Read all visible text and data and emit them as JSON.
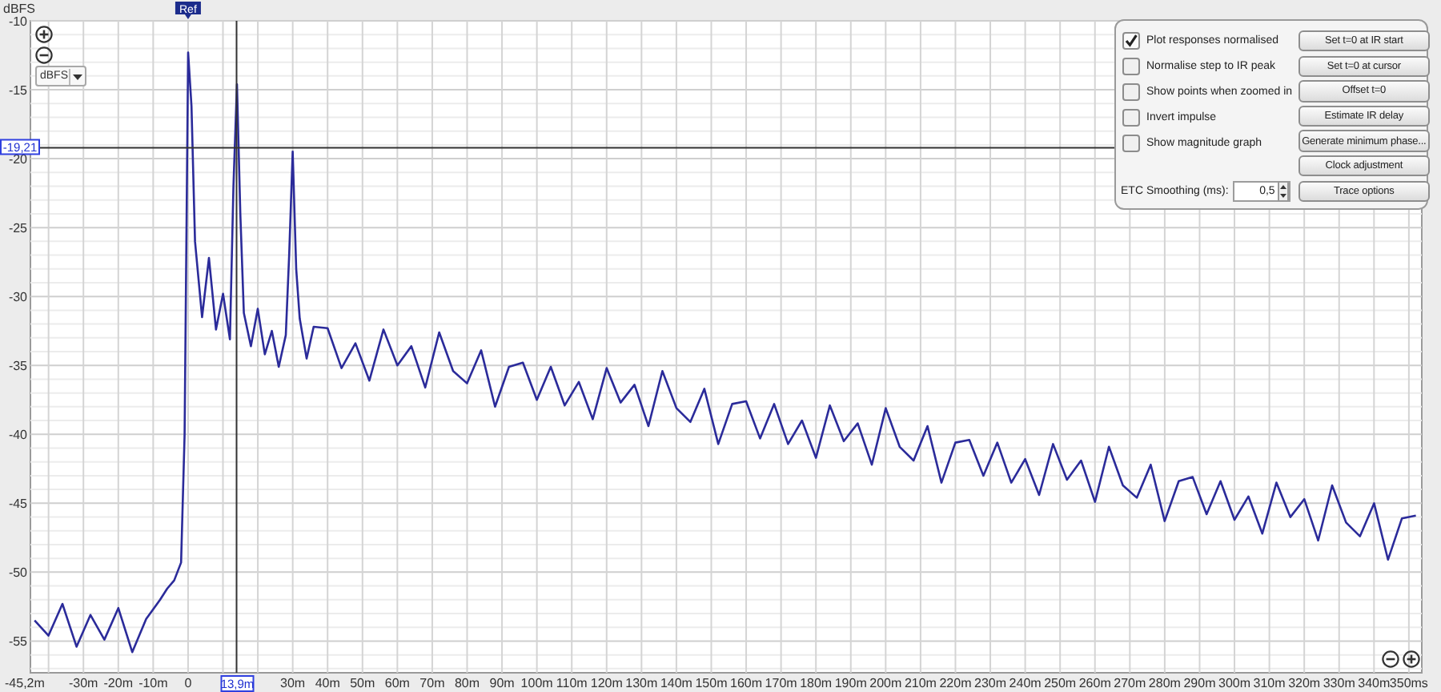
{
  "chart": {
    "chart_data": {
      "type": "line",
      "ylabel": "dBFS",
      "xlim": [
        -45.2,
        353.7
      ],
      "ylim": [
        -57.3,
        -10
      ],
      "xticks": [
        {
          "value": -45.2,
          "label": "-45,2m"
        },
        {
          "value": -30,
          "label": "-30m"
        },
        {
          "value": -20,
          "label": "-20m"
        },
        {
          "value": -10,
          "label": "-10m"
        },
        {
          "value": 0,
          "label": "0"
        },
        {
          "value": 30,
          "label": "30m"
        },
        {
          "value": 40,
          "label": "40m"
        },
        {
          "value": 50,
          "label": "50m"
        },
        {
          "value": 60,
          "label": "60m"
        },
        {
          "value": 70,
          "label": "70m"
        },
        {
          "value": 80,
          "label": "80m"
        },
        {
          "value": 90,
          "label": "90m"
        },
        {
          "value": 100,
          "label": "100m"
        },
        {
          "value": 110,
          "label": "110m"
        },
        {
          "value": 120,
          "label": "120m"
        },
        {
          "value": 130,
          "label": "130m"
        },
        {
          "value": 140,
          "label": "140m"
        },
        {
          "value": 150,
          "label": "150m"
        },
        {
          "value": 160,
          "label": "160m"
        },
        {
          "value": 170,
          "label": "170m"
        },
        {
          "value": 180,
          "label": "180m"
        },
        {
          "value": 190,
          "label": "190m"
        },
        {
          "value": 200,
          "label": "200m"
        },
        {
          "value": 210,
          "label": "210m"
        },
        {
          "value": 220,
          "label": "220m"
        },
        {
          "value": 230,
          "label": "230m"
        },
        {
          "value": 240,
          "label": "240m"
        },
        {
          "value": 250,
          "label": "250m"
        },
        {
          "value": 260,
          "label": "260m"
        },
        {
          "value": 270,
          "label": "270m"
        },
        {
          "value": 280,
          "label": "280m"
        },
        {
          "value": 290,
          "label": "290m"
        },
        {
          "value": 300,
          "label": "300m"
        },
        {
          "value": 310,
          "label": "310m"
        },
        {
          "value": 320,
          "label": "320m"
        },
        {
          "value": 330,
          "label": "330m"
        },
        {
          "value": 340,
          "label": "340m"
        },
        {
          "value": 350,
          "label": "350ms"
        }
      ],
      "yticks": [
        -10,
        -15,
        -20,
        -25,
        -30,
        -35,
        -40,
        -45,
        -50,
        -55
      ],
      "x": [
        -44,
        -40,
        -36,
        -32,
        -28,
        -24,
        -20,
        -16,
        -12,
        -8,
        -6,
        -4,
        -2,
        -1,
        0,
        1,
        2,
        4,
        6,
        8,
        10,
        12,
        13,
        14,
        15,
        16,
        18,
        20,
        22,
        24,
        26,
        28,
        29,
        30,
        31,
        32,
        34,
        36,
        40,
        44,
        48,
        52,
        56,
        60,
        64,
        68,
        72,
        76,
        80,
        84,
        88,
        92,
        96,
        100,
        104,
        108,
        112,
        116,
        120,
        124,
        128,
        132,
        136,
        140,
        144,
        148,
        152,
        156,
        160,
        164,
        168,
        172,
        176,
        180,
        184,
        188,
        192,
        196,
        200,
        204,
        208,
        212,
        216,
        220,
        224,
        228,
        232,
        236,
        240,
        244,
        248,
        252,
        256,
        260,
        264,
        268,
        272,
        276,
        280,
        284,
        288,
        292,
        296,
        300,
        304,
        308,
        312,
        316,
        320,
        324,
        328,
        332,
        336,
        340,
        344,
        348,
        352
      ],
      "series": [
        {
          "color": "#2b2b9a",
          "values": [
            -53.5,
            -54.6,
            -52.3,
            -55.4,
            -53.1,
            -54.9,
            -52.6,
            -55.8,
            -53.4,
            -52.0,
            -51.2,
            -50.6,
            -49.3,
            -40,
            -12.3,
            -16.2,
            -26,
            -31.5,
            -27.2,
            -32.4,
            -29.8,
            -33.1,
            -22,
            -14.6,
            -24,
            -31.2,
            -33.6,
            -30.9,
            -34.2,
            -32.5,
            -35.1,
            -32.8,
            -27,
            -19.5,
            -28,
            -31.6,
            -34.5,
            -32.2,
            -32.3,
            -35.2,
            -33.4,
            -36.1,
            -32.4,
            -35.0,
            -33.6,
            -36.6,
            -32.6,
            -35.4,
            -36.3,
            -33.9,
            -38.0,
            -35.1,
            -34.8,
            -37.5,
            -35.1,
            -37.9,
            -36.2,
            -38.9,
            -35.2,
            -37.7,
            -36.4,
            -39.4,
            -35.4,
            -38.1,
            -39.1,
            -36.7,
            -40.7,
            -37.8,
            -37.6,
            -40.3,
            -37.8,
            -40.7,
            -39.0,
            -41.7,
            -37.9,
            -40.5,
            -39.2,
            -42.2,
            -38.1,
            -40.9,
            -41.9,
            -39.4,
            -43.5,
            -40.6,
            -40.4,
            -43.0,
            -40.6,
            -43.5,
            -41.8,
            -44.4,
            -40.7,
            -43.3,
            -41.9,
            -44.9,
            -40.9,
            -43.7,
            -44.6,
            -42.2,
            -46.3,
            -43.4,
            -43.1,
            -45.8,
            -43.4,
            -46.2,
            -44.5,
            -47.2,
            -43.5,
            -46.0,
            -44.7,
            -47.7,
            -43.7,
            -46.4,
            -47.4,
            -45.0,
            -49.1,
            -46.1,
            -45.9
          ]
        }
      ],
      "grid": true,
      "annotations": [
        {
          "text": "Ref",
          "x": 0
        }
      ],
      "ref_lines": [
        {
          "axis": "x",
          "value": 13.9,
          "label": "13,9m"
        },
        {
          "axis": "y",
          "value": -19.21,
          "label": "-19,21"
        }
      ]
    },
    "unit_select": {
      "value": "dBFS"
    }
  },
  "options": [
    {
      "label": "Plot responses normalised",
      "checked": true
    },
    {
      "label": "Normalise step to IR peak",
      "checked": false
    },
    {
      "label": "Show points when zoomed in",
      "checked": false
    },
    {
      "label": "Invert impulse",
      "checked": false
    },
    {
      "label": "Show magnitude graph",
      "checked": false
    }
  ],
  "buttons": [
    "Set t=0 at IR start",
    "Set t=0 at cursor",
    "Offset t=0",
    "Estimate IR delay",
    "Generate minimum phase...",
    "Clock adjustment",
    "Trace options"
  ],
  "smoothing": {
    "label": "ETC Smoothing (ms):",
    "value": "0,5"
  }
}
